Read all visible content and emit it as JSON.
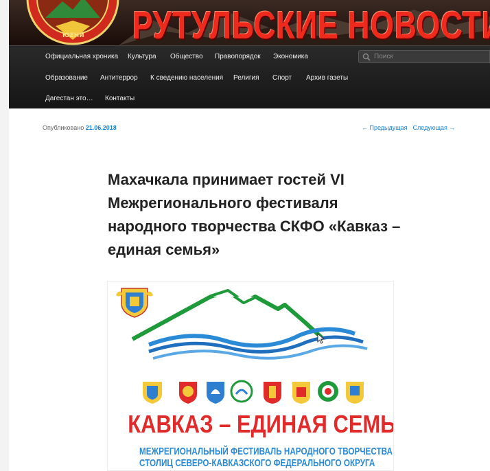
{
  "site": {
    "banner_title": "РУТУЛЬСКИЕ НОВОСТИ"
  },
  "nav": {
    "row1": [
      "Официальная хроника",
      "Культура",
      "Общество",
      "Правопорядок",
      "Экономика"
    ],
    "row2": [
      "Образование",
      "Антитеррор",
      "К сведению населения",
      "Религия",
      "Спорт",
      "Архив газеты"
    ],
    "row3": [
      "Дагестан это…",
      "Контакты"
    ],
    "search_placeholder": "Поиск"
  },
  "post": {
    "published_label": "Опубликовано",
    "date": "21.06.2018",
    "prev_label": "← Предыдущая",
    "next_label": "Следующая →",
    "title": "Махачкала принимает гостей VI Межрегионального фестиваля народного творчества СКФО «Кавказ – единая семья»"
  },
  "poster": {
    "heading": "КАВКАЗ – ЕДИНАЯ СЕМЬЯ",
    "subtitle_line1": "МЕЖРЕГИОНАЛЬНЫЙ ФЕСТИВАЛЬ НАРОДНОГО ТВОРЧЕСТВА",
    "subtitle_line2": "СТОЛИЦ СЕВЕРО-КАВКАЗСКОГО ФЕДЕРАЛЬНОГО ОКРУГА",
    "emblems": [
      "makhachkala-emblem",
      "dagestan-emblem",
      "krasnodar-emblem",
      "chechnya-emblem",
      "stavropol-emblem",
      "ingushetia-emblem",
      "circassia-emblem",
      "ossetia-emblem"
    ]
  },
  "colors": {
    "nav_bg": "#1e1e1e",
    "link": "#1982d1",
    "banner_text": "#ee2a1c",
    "poster_red": "#e12a2a",
    "poster_blue": "#2b8ad6",
    "mountain_green": "#1f9a3a"
  }
}
